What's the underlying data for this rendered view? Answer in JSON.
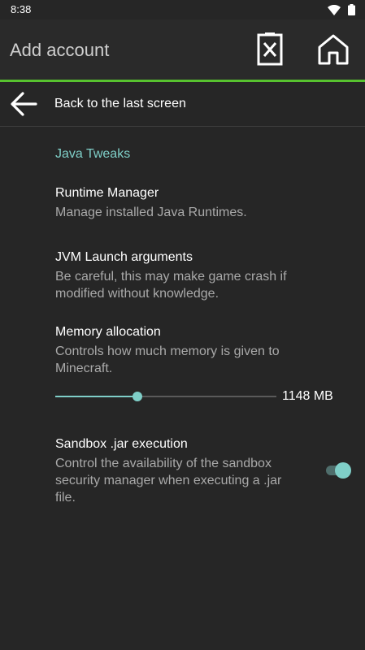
{
  "status_bar": {
    "time": "8:38",
    "icons": [
      "wifi-icon",
      "battery-icon"
    ]
  },
  "app_bar": {
    "title": "Add account",
    "actions": [
      "close-file-icon",
      "home-icon"
    ],
    "accent_color": "#57c22f"
  },
  "back": {
    "label": "Back to the last screen",
    "icon": "arrow-back-icon"
  },
  "category": {
    "title": "Java Tweaks",
    "color": "#7fcfc8"
  },
  "prefs": [
    {
      "title": "Runtime Manager",
      "summary": "Manage installed Java Runtimes."
    },
    {
      "title": "JVM Launch arguments",
      "summary": "Be careful, this may make game crash if modified without knowledge."
    },
    {
      "title": "Memory allocation",
      "summary": "Controls how much memory is given to Minecraft."
    },
    {
      "title": "Sandbox .jar execution",
      "summary": "Control the availability of the sandbox security manager when executing a .jar file."
    }
  ],
  "memory_slider": {
    "value_label": "1148 MB",
    "fraction": 0.37
  },
  "sandbox_switch": {
    "on": true
  }
}
